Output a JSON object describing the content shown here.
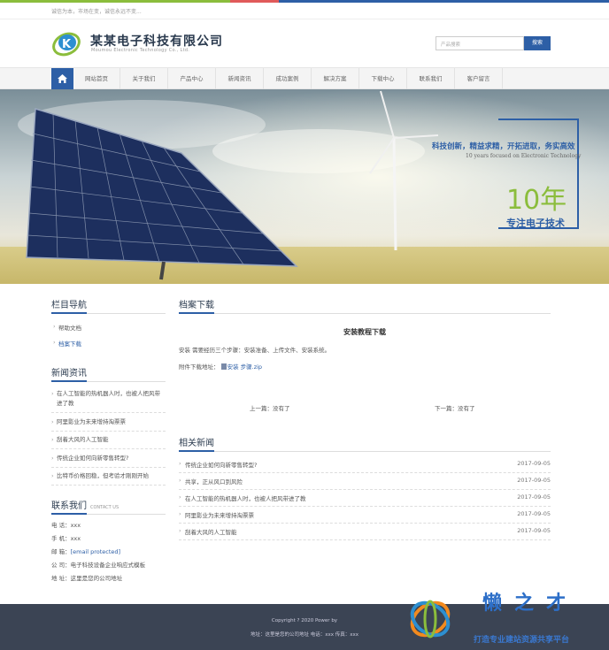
{
  "colors": {
    "brand": "#2d5fa6",
    "accent_green": "#8bbd3c",
    "footer_bg": "#3b4454"
  },
  "topbar": {
    "slogan": "诚信为本，市场在变，诚信永远不变..."
  },
  "header": {
    "company_name": "某某电子科技有限公司",
    "company_name_en": "Moumou Electronic Technology Co., Ltd.",
    "logo_icon": "k-swoosh-logo"
  },
  "search": {
    "placeholder": "产品搜索",
    "button_label": "搜索"
  },
  "nav": {
    "home_icon": "home-icon",
    "items": [
      "网站首页",
      "关于我们",
      "产品中心",
      "新闻资讯",
      "成功案例",
      "解决方案",
      "下载中心",
      "联系我们",
      "客户留言"
    ]
  },
  "banner": {
    "slogan": "科技创新，精益求精，开拓进取，务实高效",
    "slogan_en": "10 years focused on Electronic Technology",
    "years": "10年",
    "focus": "专注电子技术"
  },
  "sidebar": {
    "nav_title": "栏目导航",
    "nav_items": [
      "帮助文档",
      "档案下载"
    ],
    "news_title": "新闻资讯",
    "news_items": [
      "在人工智能的热机器人时，也被人把风带进了教",
      "阿里影业为未来增持淘票票",
      "刮着大风的人工智能",
      "传统企业如何向新零售转型?",
      "比特币价格回稳，但考验才刚刚开始"
    ],
    "contact_title": "联系我们",
    "contact_title_en": "CONTACT US",
    "contact": [
      {
        "label": "电 话：",
        "value": "xxx"
      },
      {
        "label": "手 机：",
        "value": "xxx"
      },
      {
        "label": "邮 箱：",
        "value": "[email protected]"
      },
      {
        "label": "公 司：",
        "value": "电子科技设备企业响应式模板"
      },
      {
        "label": "地 址：",
        "value": "这里是您的公司地址"
      }
    ]
  },
  "main": {
    "section_title": "档案下载",
    "article_title": "安装教程下载",
    "article_body": "安装 需要经历三个步骤：安装准备、上传文件、安装系统。",
    "attach_label": "附件下载地址：",
    "attach_file": "安装 步骤.zip",
    "prev": "上一篇：没有了",
    "next": "下一篇：没有了",
    "related_title": "相关新闻",
    "related": [
      {
        "title": "传统企业如何向新零售转型?",
        "date": "2017-09-05"
      },
      {
        "title": "共享，正从风口到风险",
        "date": "2017-09-05"
      },
      {
        "title": "在人工智能的热机器人时，也被人把风带进了教",
        "date": "2017-09-05"
      },
      {
        "title": "阿里影业为未来增持淘票票",
        "date": "2017-09-05"
      },
      {
        "title": "刮着大风的人工智能",
        "date": "2017-09-05"
      }
    ]
  },
  "footer": {
    "copyright": "Copyright ? 2020 Power by",
    "address_line": "地址：这里是您的公司地址  电话：xxx  传真：xxx"
  },
  "watermark": {
    "title": "懒之才",
    "subtitle": "打造专业建站资源共享平台"
  }
}
